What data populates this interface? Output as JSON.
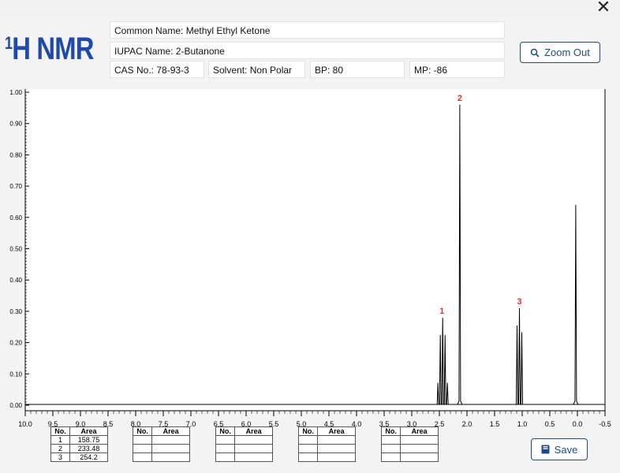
{
  "window": {
    "close_symbol": "✕"
  },
  "header": {
    "title_sup": "1",
    "title_main": "H NMR",
    "common_name": "Common Name: Methyl Ethyl Ketone",
    "iupac_name": "IUPAC Name: 2-Butanone",
    "cas": "CAS No.: 78-93-3",
    "solvent": "Solvent: Non Polar",
    "bp": "BP: 80",
    "mp": "MP: -86"
  },
  "buttons": {
    "zoom_out": "Zoom Out",
    "save": "Save"
  },
  "colors": {
    "accent": "#1f4aa8",
    "peak_label": "#e53030",
    "spectrum": "#000000"
  },
  "chart_data": {
    "type": "line",
    "title": "",
    "xlabel": "",
    "ylabel": "",
    "xlim": [
      10.0,
      -0.5
    ],
    "ylim": [
      0.0,
      1.0
    ],
    "x_ticks": [
      "10.0",
      "9.5",
      "9.0",
      "8.5",
      "8.0",
      "7.5",
      "7.0",
      "6.5",
      "6.0",
      "5.5",
      "5.0",
      "4.5",
      "4.0",
      "3.5",
      "3.0",
      "2.5",
      "2.0",
      "1.5",
      "1.0",
      "0.5",
      "0.0",
      "-0.5"
    ],
    "y_ticks": [
      "0.00",
      "0.10",
      "0.20",
      "0.30",
      "0.40",
      "0.50",
      "0.60",
      "0.70",
      "0.80",
      "0.90",
      "1.00"
    ],
    "peaks": [
      {
        "label": "1",
        "shift": 2.44,
        "height": 0.28
      },
      {
        "label": "2",
        "shift": 2.13,
        "height": 0.96
      },
      {
        "label": "3",
        "shift": 1.05,
        "height": 0.31
      },
      {
        "label": "",
        "shift": 0.03,
        "height": 0.64
      }
    ],
    "grid": false
  },
  "area_tables": [
    {
      "headers": [
        "No.",
        "Area"
      ],
      "rows": [
        [
          "1",
          "158.75"
        ],
        [
          "2",
          "233.48"
        ],
        [
          "3",
          "254.2"
        ]
      ]
    },
    {
      "headers": [
        "No.",
        "Area"
      ],
      "rows": [
        [
          "",
          ""
        ],
        [
          "",
          ""
        ],
        [
          "",
          ""
        ]
      ]
    },
    {
      "headers": [
        "No.",
        "Area"
      ],
      "rows": [
        [
          "",
          ""
        ],
        [
          "",
          ""
        ],
        [
          "",
          ""
        ]
      ]
    },
    {
      "headers": [
        "No.",
        "Area"
      ],
      "rows": [
        [
          "",
          ""
        ],
        [
          "",
          ""
        ],
        [
          "",
          ""
        ]
      ]
    },
    {
      "headers": [
        "No.",
        "Area"
      ],
      "rows": [
        [
          "",
          ""
        ],
        [
          "",
          ""
        ],
        [
          "",
          ""
        ]
      ]
    }
  ]
}
